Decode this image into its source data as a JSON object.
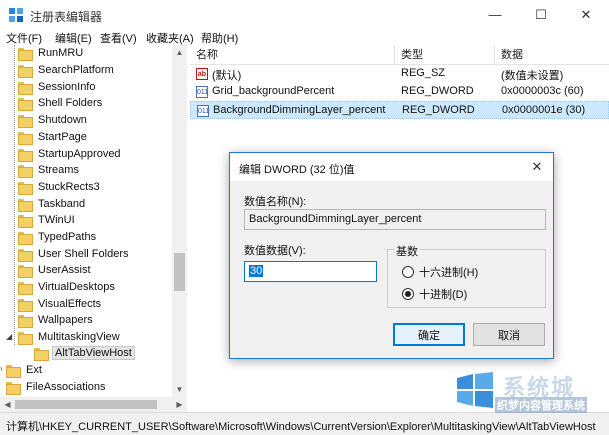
{
  "window": {
    "title": "注册表编辑器",
    "minimize": "—",
    "maximize": "☐",
    "close": "✕"
  },
  "menu": [
    "文件(F)",
    "编辑(E)",
    "查看(V)",
    "收藏夹(A)",
    "帮助(H)"
  ],
  "tree": {
    "items": [
      {
        "label": "RunMRU"
      },
      {
        "label": "SearchPlatform"
      },
      {
        "label": "SessionInfo"
      },
      {
        "label": "Shell Folders"
      },
      {
        "label": "Shutdown"
      },
      {
        "label": "StartPage"
      },
      {
        "label": "StartupApproved"
      },
      {
        "label": "Streams"
      },
      {
        "label": "StuckRects3"
      },
      {
        "label": "Taskband"
      },
      {
        "label": "TWinUI"
      },
      {
        "label": "TypedPaths"
      },
      {
        "label": "User Shell Folders"
      },
      {
        "label": "UserAssist"
      },
      {
        "label": "VirtualDesktops"
      },
      {
        "label": "VisualEffects"
      },
      {
        "label": "Wallpapers"
      },
      {
        "label": "MultitaskingView"
      },
      {
        "label": "AltTabViewHost"
      },
      {
        "label": "Ext"
      },
      {
        "label": "FileAssociations"
      }
    ],
    "expanded_marker": "◢",
    "collapsed_marker": "›"
  },
  "list": {
    "columns": [
      "名称",
      "类型",
      "数据"
    ],
    "rows": [
      {
        "icon": "ab",
        "name": "(默认)",
        "type": "REG_SZ",
        "data": "(数值未设置)"
      },
      {
        "icon": "011",
        "name": "Grid_backgroundPercent",
        "type": "REG_DWORD",
        "data": "0x0000003c (60)"
      },
      {
        "icon": "011",
        "name": "BackgroundDimmingLayer_percent",
        "type": "REG_DWORD",
        "data": "0x0000001e (30)"
      }
    ]
  },
  "dialog": {
    "title": "编辑 DWORD (32 位)值",
    "close": "✕",
    "name_label": "数值名称(N):",
    "name_value": "BackgroundDimmingLayer_percent",
    "data_label": "数值数据(V):",
    "data_value": "30",
    "base_label": "基数",
    "radio_hex": "十六进制(H)",
    "radio_dec": "十进制(D)",
    "ok": "确定",
    "cancel": "取消"
  },
  "status": {
    "path": "计算机\\HKEY_CURRENT_USER\\Software\\Microsoft\\Windows\\CurrentVersion\\Explorer\\MultitaskingView\\AltTabViewHost"
  },
  "watermark": {
    "line1": "系统城",
    "line2": "织梦内容管理系统"
  },
  "colors": {
    "selection": "#cce8ff",
    "accent": "#0078d7",
    "folder": "#f4cf63"
  }
}
